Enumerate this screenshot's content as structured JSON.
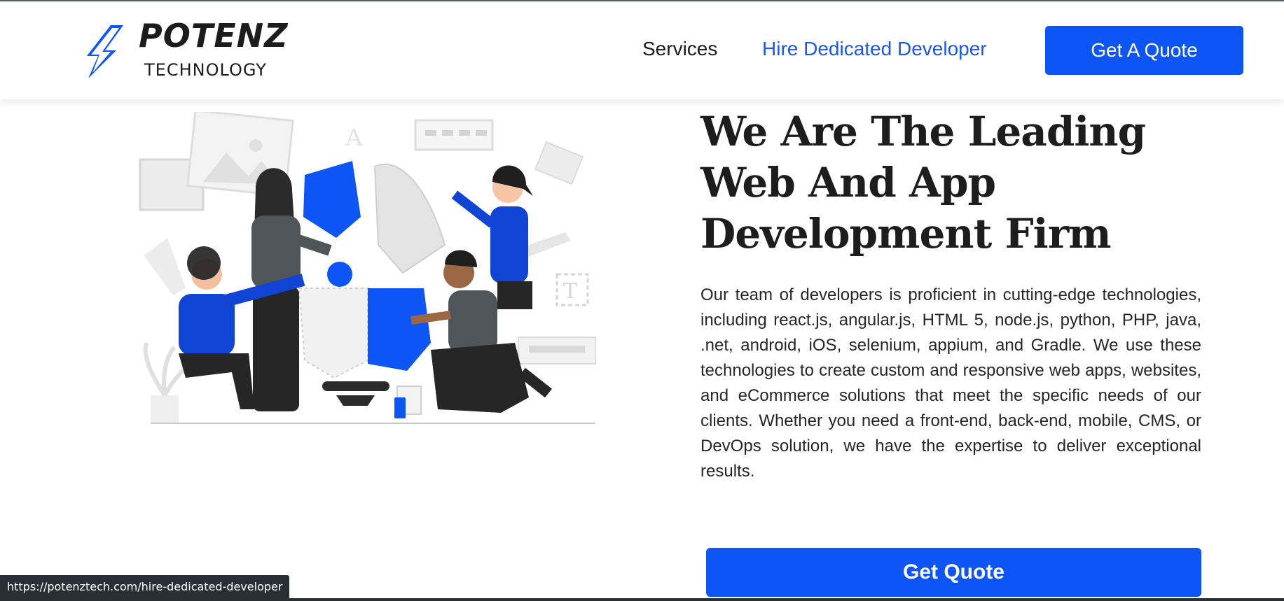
{
  "logo": {
    "name": "POTENZ",
    "tagline": "TECHNOLOGY"
  },
  "nav": {
    "services": "Services",
    "hire": "Hire Dedicated Developer",
    "quote_button": "Get A Quote"
  },
  "hero": {
    "title": "We Are The Leading Web And App Development Firm",
    "description": "Our team of developers is proficient in cutting-edge technologies, including react.js, angular.js, HTML 5, node.js, python, PHP, java, .net, android, iOS, selenium, appium, and Gradle. We use these technologies to create custom and responsive web apps, websites, and eCommerce solutions that meet the specific needs of our clients. Whether you need a front-end, back-end, mobile, CMS, or DevOps solution, we have the expertise to deliver exceptional results.",
    "button": "Get Quote"
  },
  "status_bar": {
    "url": "https://potenztech.com/hire-dedicated-developer"
  },
  "colors": {
    "accent": "#0d56f5",
    "link_active": "#1a57f0",
    "text_dark": "#1d1d1d"
  }
}
